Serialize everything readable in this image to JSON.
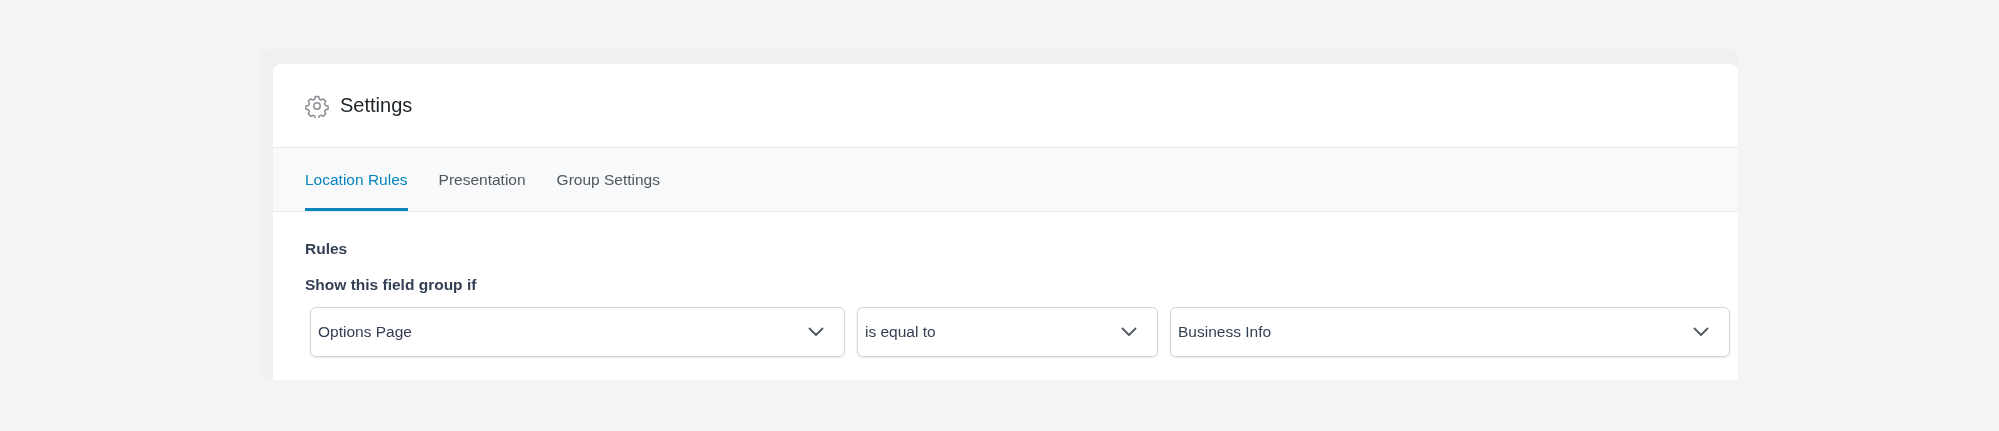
{
  "panel": {
    "title": "Settings"
  },
  "tabs": [
    {
      "label": "Location Rules",
      "selected": true
    },
    {
      "label": "Presentation",
      "selected": false
    },
    {
      "label": "Group Settings",
      "selected": false
    }
  ],
  "rules": {
    "heading": "Rules",
    "condition_label": "Show this field group if",
    "selects": [
      {
        "value": "Options Page"
      },
      {
        "value": "is equal to"
      },
      {
        "value": "Business Info"
      }
    ]
  }
}
